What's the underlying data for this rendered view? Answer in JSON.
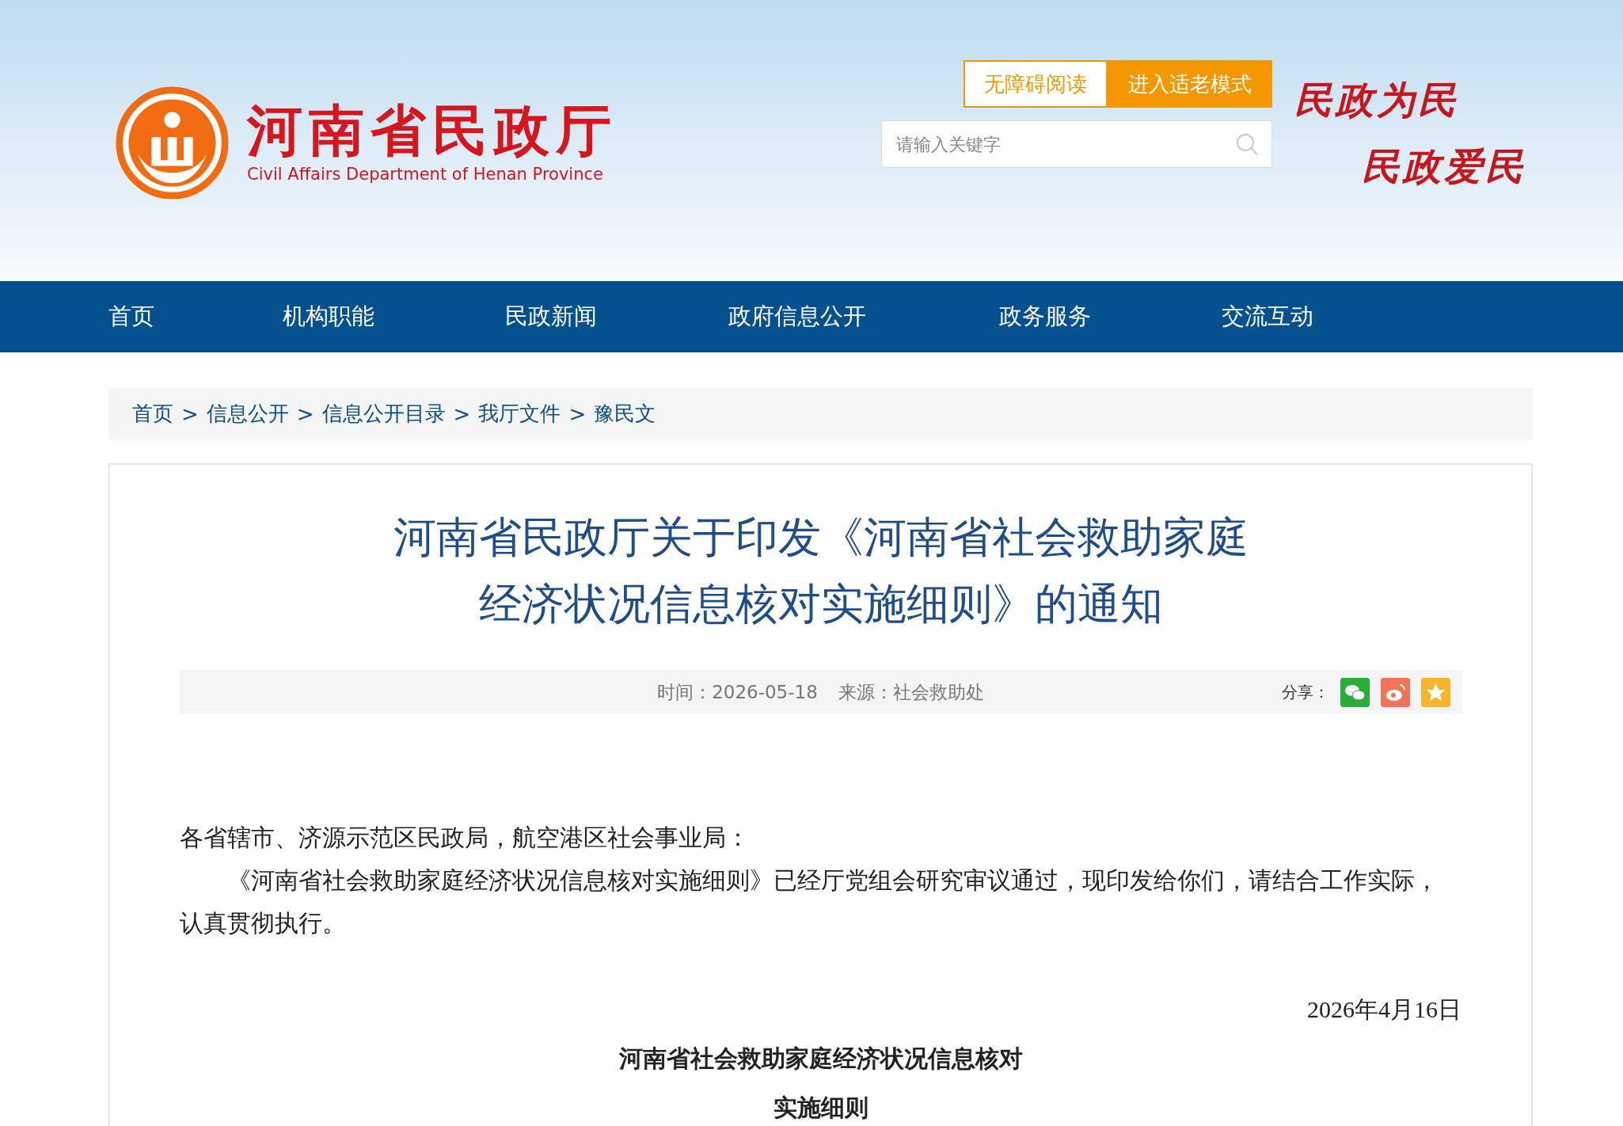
{
  "header": {
    "site_name": "河南省民政厅",
    "site_name_en": "Civil Affairs Department of Henan Province",
    "buttons": [
      {
        "label": "无障碍阅读",
        "kind": "outline"
      },
      {
        "label": "进入适老模式",
        "kind": "filled"
      }
    ],
    "search": {
      "placeholder": "请输入关键字"
    },
    "slogans": [
      "民政为民",
      "民政爱民"
    ]
  },
  "nav": [
    {
      "label": "首页"
    },
    {
      "label": "机构职能"
    },
    {
      "label": "民政新闻"
    },
    {
      "label": "政府信息公开"
    },
    {
      "label": "政务服务"
    },
    {
      "label": "交流互动"
    }
  ],
  "breadcrumb": {
    "items": [
      "首页",
      "信息公开",
      "信息公开目录",
      "我厅文件",
      "豫民文"
    ],
    "separator": ">"
  },
  "article": {
    "title": "河南省民政厅关于印发《河南省社会救助家庭经济状况信息核对实施细则》的通知",
    "meta": [
      {
        "label": "时间：",
        "value": "2026-05-18"
      },
      {
        "label": "来源：",
        "value": "社会救助处"
      }
    ],
    "share": {
      "label": "分享：",
      "icons": [
        {
          "kind": "wechat",
          "color": "#2aae3b"
        },
        {
          "kind": "weibo",
          "color": "#f0735a"
        },
        {
          "kind": "favorite",
          "color": "#f7b52c"
        }
      ]
    },
    "body": [
      {
        "kind": "salutation",
        "text": "各省辖市、济源示范区民政局，航空港区社会事业局："
      },
      {
        "kind": "paragraph",
        "text": "《河南省社会救助家庭经济状况信息核对实施细则》已经厅党组会研究审议通过，现印发给你们，请结合工作实际，认真贯彻执行。"
      },
      {
        "kind": "date",
        "text": "2026年4月16日"
      },
      {
        "kind": "heading",
        "text": "河南省社会救助家庭经济状况信息核对"
      },
      {
        "kind": "heading",
        "text": "实施细则"
      }
    ]
  }
}
